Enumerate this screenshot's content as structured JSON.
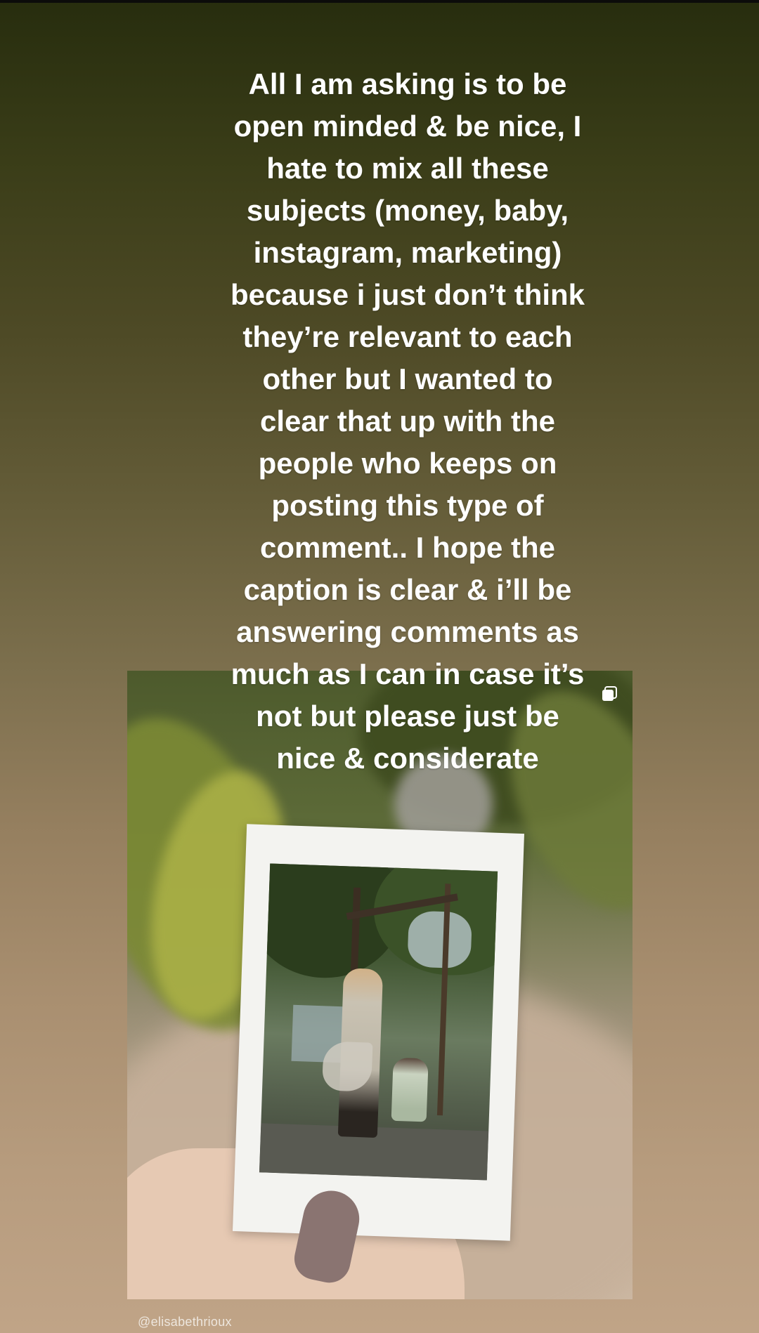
{
  "story": {
    "text": "All I am asking is to be\nopen minded & be nice, I\nhate to mix all these\nsubjects (money, baby,\ninstagram, marketing)\nbecause i just don’t think\nthey’re relevant to each\nother but I wanted to\nclear that up with the\npeople who keeps on\nposting this type of\ncomment.. I hope the\ncaption is clear & i’ll be\nanswering comments as\nmuch as I can in case it’s\nnot but please just be\nnice & considerate"
  },
  "post": {
    "username": "@elisabethrioux",
    "multi_icon": "carousel-icon"
  }
}
